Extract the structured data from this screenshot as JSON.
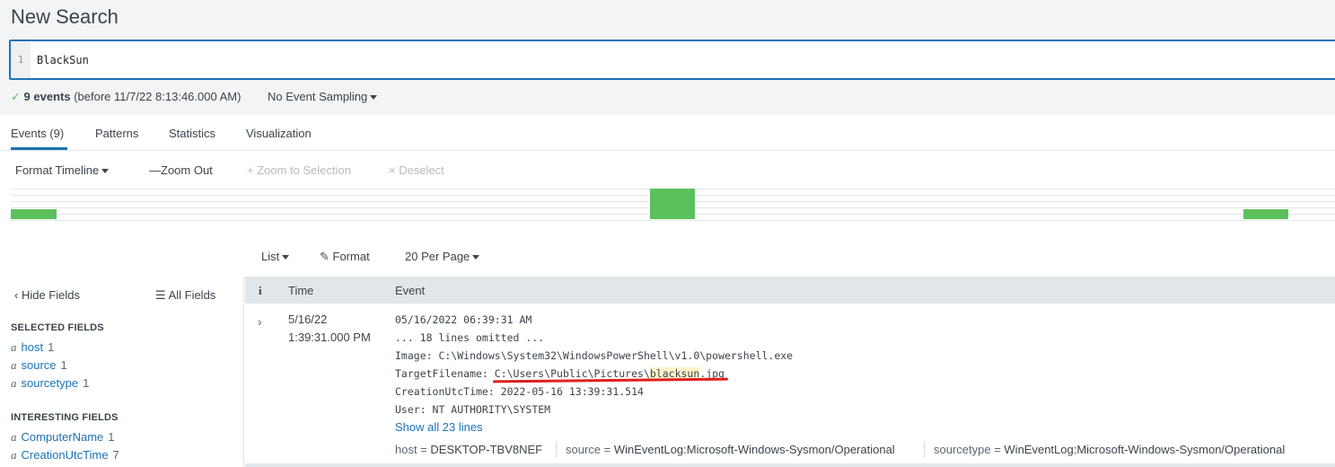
{
  "page": {
    "title": "New Search"
  },
  "search": {
    "line_number": "1",
    "query": "BlackSun"
  },
  "status": {
    "check": "✓",
    "event_count": "9 events",
    "time_note": "(before 11/7/22 8:13:46.000 AM)",
    "sampling": "No Event Sampling"
  },
  "tabs": [
    {
      "label": "Events (9)",
      "active": true
    },
    {
      "label": "Patterns"
    },
    {
      "label": "Statistics"
    },
    {
      "label": "Visualization"
    }
  ],
  "timeline_toolbar": {
    "format_timeline": "Format Timeline",
    "zoom_out": "Zoom Out",
    "zoom_selection": "Zoom to Selection",
    "deselect": "Deselect"
  },
  "timeline": {
    "bar_color": "#5cc05c"
  },
  "results_toolbar": {
    "view": "List",
    "format": "Format",
    "per_page": "20 Per Page"
  },
  "sidebar": {
    "hide_fields": "Hide Fields",
    "all_fields": "All Fields",
    "selected_heading": "SELECTED FIELDS",
    "selected_fields": [
      {
        "type": "a",
        "name": "host",
        "count": "1"
      },
      {
        "type": "a",
        "name": "source",
        "count": "1"
      },
      {
        "type": "a",
        "name": "sourcetype",
        "count": "1"
      }
    ],
    "interesting_heading": "INTERESTING FIELDS",
    "interesting_fields": [
      {
        "type": "a",
        "name": "ComputerName",
        "count": "1"
      },
      {
        "type": "a",
        "name": "CreationUtcTime",
        "count": "7"
      }
    ]
  },
  "table": {
    "headers": {
      "info": "i",
      "time": "Time",
      "event": "Event"
    },
    "rows": [
      {
        "time_date": "5/16/22",
        "time_clock": "1:39:31.000 PM",
        "lines": [
          "05/16/2022 06:39:31 AM",
          "... 18 lines omitted ...",
          "Image: C:\\Windows\\System32\\WindowsPowerShell\\v1.0\\powershell.exe",
          "CreationUtcTime: 2022-05-16 13:39:31.514",
          "User: NT AUTHORITY\\SYSTEM"
        ],
        "target_label": "TargetFilename: ",
        "target_path_prefix": "C:\\Users\\Public\\Pictures\\",
        "target_highlight": "blacksun",
        "target_suffix": ".jpg",
        "show_all": "Show all 23 lines",
        "meta": {
          "host_label": "host = ",
          "host": "DESKTOP-TBV8NEF",
          "source_label": "source = ",
          "source": "WinEventLog:Microsoft-Windows-Sysmon/Operational",
          "sourcetype_label": "sourcetype = ",
          "sourcetype": "WinEventLog:Microsoft-Windows-Sysmon/Operational"
        }
      }
    ]
  },
  "colors": {
    "accent": "#1a73b5",
    "annotation_underline": "#e0201b",
    "highlight": "#fdf2c9"
  }
}
